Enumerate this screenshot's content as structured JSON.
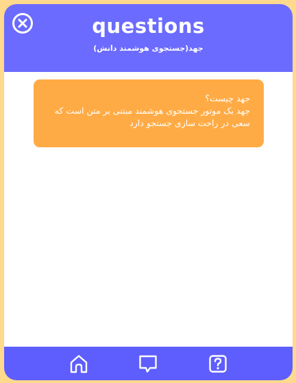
{
  "header": {
    "title": "questions",
    "subtitle": "جهد(جستجوی هوشمند دانش)"
  },
  "card": {
    "question": "جهد چیست؟",
    "answer": "جهد یک موتور جستجوی هوشمند مبتنی بر متن است که سعی در راحت سازی جستجو دارد"
  },
  "icons": {
    "close": "close-icon",
    "home": "home-icon",
    "chat": "chat-icon",
    "help": "question-icon"
  },
  "colors": {
    "background": "#FFD98C",
    "header": "#6B6BFF",
    "card": "#FFAB45",
    "bottom_bar": "#5E5EFF"
  }
}
